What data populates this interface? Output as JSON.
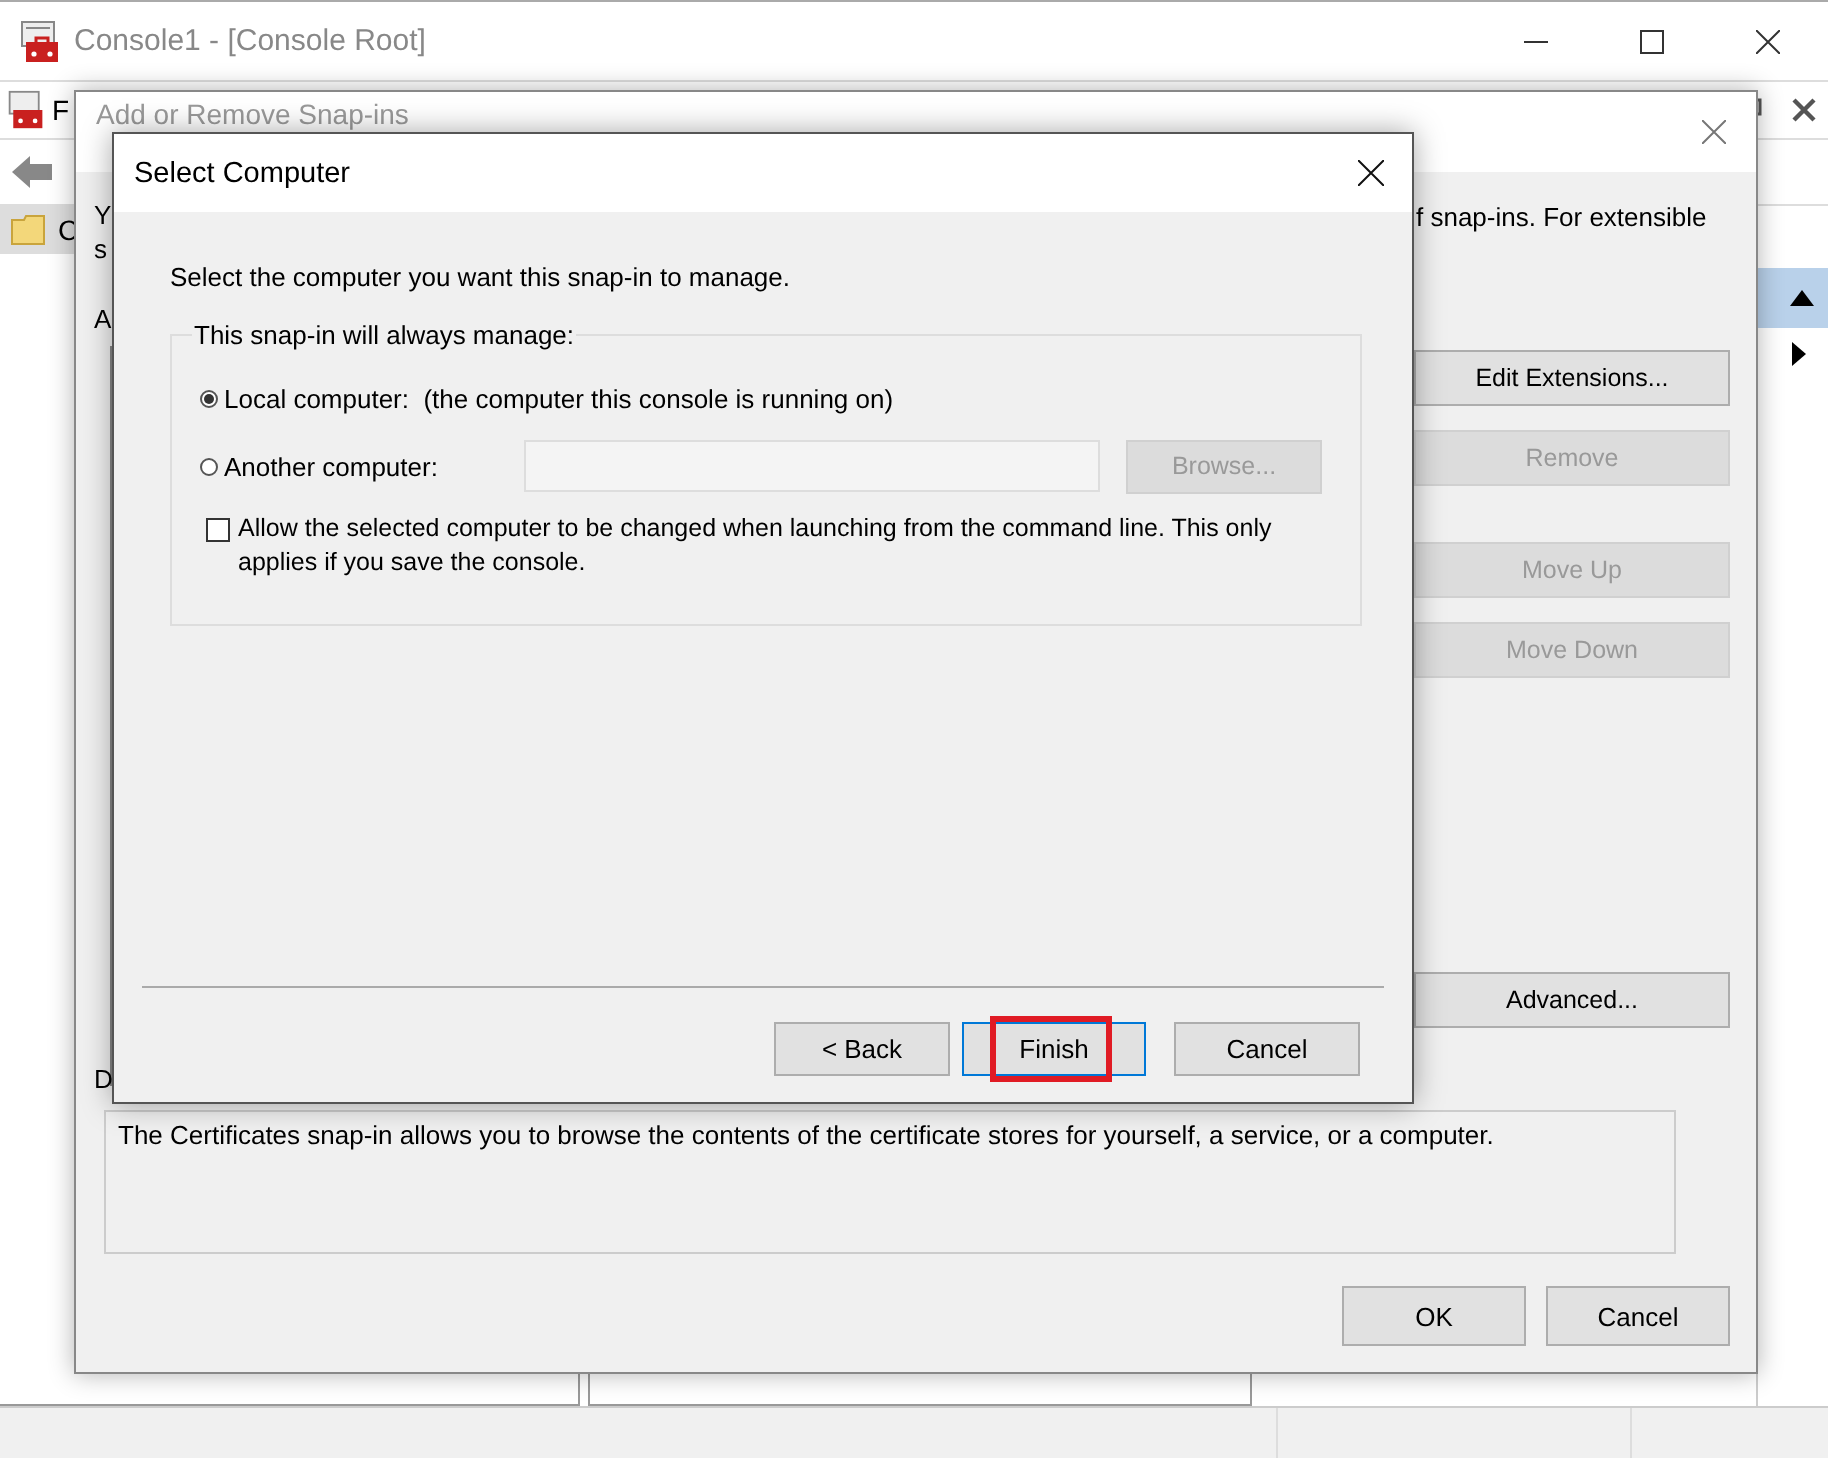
{
  "console_window": {
    "title": "Console1 - [Console Root]",
    "menu_fragment": "F",
    "tree_fragment": "C"
  },
  "snapins_dialog": {
    "title": "Add or Remove Snap-ins",
    "intro_fragments": [
      "Y",
      "s"
    ],
    "intro_tail": "f snap-ins. For extensible",
    "list_label_fragment": "A",
    "description_label_fragment": "D",
    "side_buttons": [
      {
        "label": "Edit Extensions...",
        "disabled": false
      },
      {
        "label": "Remove",
        "disabled": true
      },
      {
        "label": "Move Up",
        "disabled": true
      },
      {
        "label": "Move Down",
        "disabled": true
      },
      {
        "label": "Advanced...",
        "disabled": false
      }
    ],
    "description": "The Certificates snap-in allows you to browse the contents of the certificate stores for yourself, a service, or a computer.",
    "buttons": [
      {
        "label": "OK"
      },
      {
        "label": "Cancel"
      }
    ]
  },
  "select_computer_dialog": {
    "title": "Select Computer",
    "prompt": "Select the computer you want this snap-in to manage.",
    "group_label": "This snap-in will always manage:",
    "options": [
      {
        "label": "Local computer:  (the computer this console is running on)",
        "selected": true
      },
      {
        "label": "Another computer:",
        "selected": false
      }
    ],
    "browse_button": {
      "label": "Browse...",
      "disabled": true
    },
    "allow_change": {
      "label": "Allow the selected computer to be changed when launching from the command line.  This only applies if you save the console.",
      "checked": false
    },
    "buttons": [
      {
        "label": "< Back",
        "default": false,
        "highlighted": false
      },
      {
        "label": "Finish",
        "default": true,
        "highlighted": true
      },
      {
        "label": "Cancel",
        "default": false,
        "highlighted": false
      }
    ]
  }
}
